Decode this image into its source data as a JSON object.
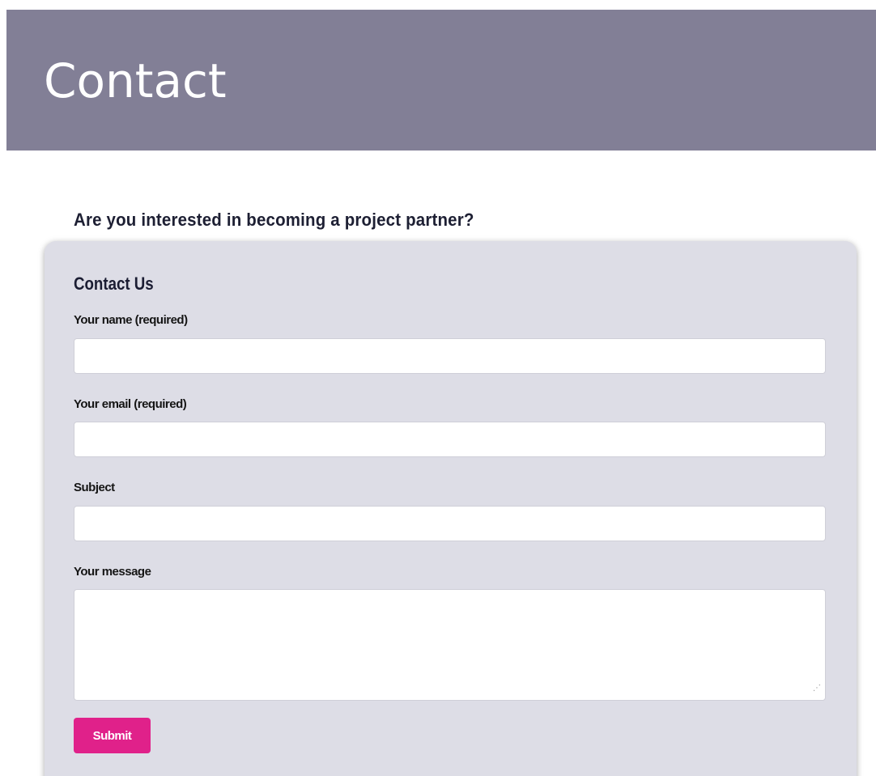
{
  "header": {
    "title": "Contact",
    "background_color": "#827f96"
  },
  "intro": {
    "heading": "Are you interested in becoming a project partner?"
  },
  "contact_form": {
    "title": "Contact Us",
    "fields": [
      {
        "label": "Your name (required)",
        "value": "",
        "type": "text"
      },
      {
        "label": "Your email (required)",
        "value": "",
        "type": "email"
      },
      {
        "label": "Subject",
        "value": "",
        "type": "text"
      },
      {
        "label": "Your message",
        "value": "",
        "type": "textarea"
      }
    ],
    "submit_label": "Submit",
    "resize_icon": "resize-grip-icon",
    "panel_color": "#dddde6",
    "accent_color": "#e0218a"
  }
}
